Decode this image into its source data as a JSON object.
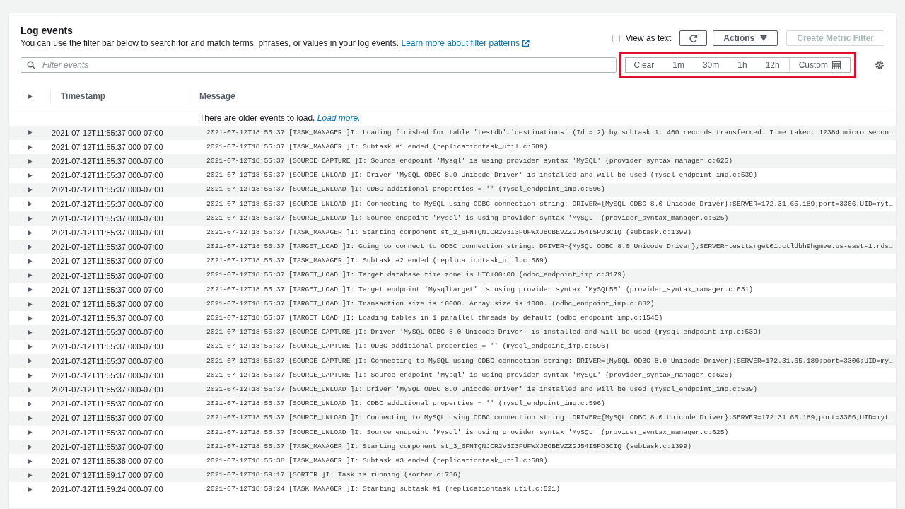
{
  "panel": {
    "title": "Log events",
    "description": "You can use the filter bar below to search for and match terms, phrases, or values in your log events.",
    "learn_more_link": "Learn more about filter patterns"
  },
  "view_as_text": {
    "label": "View as text",
    "checked": false
  },
  "actions_button": "Actions",
  "create_metric_filter": {
    "label": "Create Metric Filter",
    "disabled": true
  },
  "search": {
    "placeholder": "Filter events"
  },
  "time_range": [
    {
      "label": "Clear",
      "kind": "text"
    },
    {
      "label": "1m",
      "kind": "text"
    },
    {
      "label": "30m",
      "kind": "text"
    },
    {
      "label": "1h",
      "kind": "text"
    },
    {
      "label": "12h",
      "kind": "text"
    },
    {
      "label": "Custom",
      "kind": "calendar"
    }
  ],
  "table": {
    "columns": [
      "Timestamp",
      "Message"
    ],
    "load_more": {
      "text": "There are older events to load.",
      "link": "Load more."
    },
    "rows": [
      {
        "timestamp": "2021-07-12T11:55:37.000-07:00",
        "message": "2021-07-12T18:55:37 [TASK_MANAGER ]I: Loading finished for table 'testdb'.'destinations' (Id = 2) by subtask 1. 400 records transferred. Time taken: 12384 micro secon…",
        "expanded": false
      },
      {
        "timestamp": "2021-07-12T11:55:37.000-07:00",
        "message": "2021-07-12T18:55:37 [TASK_MANAGER ]I: Subtask #1 ended (replicationtask_util.c:589)",
        "expanded": false
      },
      {
        "timestamp": "2021-07-12T11:55:37.000-07:00",
        "message": "2021-07-12T18:55:37 [SOURCE_CAPTURE ]I: Source endpoint 'Mysql' is using provider syntax 'MySQL' (provider_syntax_manager.c:625)",
        "expanded": false
      },
      {
        "timestamp": "2021-07-12T11:55:37.000-07:00",
        "message": "2021-07-12T18:55:37 [SOURCE_UNLOAD ]I: Driver 'MySQL ODBC 8.0 Unicode Driver' is installed and will be used (mysql_endpoint_imp.c:539)",
        "expanded": false
      },
      {
        "timestamp": "2021-07-12T11:55:37.000-07:00",
        "message": "2021-07-12T18:55:37 [SOURCE_UNLOAD ]I: ODBC additional properties = '' (mysql_endpoint_imp.c:596)",
        "expanded": false
      },
      {
        "timestamp": "2021-07-12T11:55:37.000-07:00",
        "message": "2021-07-12T18:55:37 [SOURCE_UNLOAD ]I: Connecting to MySQL using ODBC connection string: DRIVER={MySQL ODBC 8.0 Unicode Driver};SERVER=172.31.65.189;port=3306;UID=myt…",
        "expanded": false
      },
      {
        "timestamp": "2021-07-12T11:55:37.000-07:00",
        "message": "2021-07-12T18:55:37 [SOURCE_UNLOAD ]I: Source endpoint 'Mysql' is using provider syntax 'MySQL' (provider_syntax_manager.c:625)",
        "expanded": false
      },
      {
        "timestamp": "2021-07-12T11:55:37.000-07:00",
        "message": "2021-07-12T18:55:37 [TASK_MANAGER ]I: Starting component st_2_6FNTQNJCR2V3I3FUFWXJBOBEVZZGJ54I5PD3CIQ (subtask.c:1399)",
        "expanded": false
      },
      {
        "timestamp": "2021-07-12T11:55:37.000-07:00",
        "message": "2021-07-12T18:55:37 [TARGET_LOAD ]I: Going to connect to ODBC connection string: DRIVER={MySQL ODBC 8.0 Unicode Driver};SERVER=testtarget01.ctldbh9hgmve.us-east-1.rds…",
        "expanded": false
      },
      {
        "timestamp": "2021-07-12T11:55:37.000-07:00",
        "message": "2021-07-12T18:55:37 [TASK_MANAGER ]I: Subtask #2 ended (replicationtask_util.c:589)",
        "expanded": false
      },
      {
        "timestamp": "2021-07-12T11:55:37.000-07:00",
        "message": "2021-07-12T18:55:37 [TARGET_LOAD ]I: Target database time zone is UTC+00:00 (odbc_endpoint_imp.c:3179)",
        "expanded": false
      },
      {
        "timestamp": "2021-07-12T11:55:37.000-07:00",
        "message": "2021-07-12T18:55:37 [TARGET_LOAD ]I: Target endpoint 'Mysqltarget' is using provider syntax 'MySQL55' (provider_syntax_manager.c:631)",
        "expanded": false
      },
      {
        "timestamp": "2021-07-12T11:55:37.000-07:00",
        "message": "2021-07-12T18:55:37 [TARGET_LOAD ]I: Transaction size is 10000. Array size is 1000. (odbc_endpoint_imp.c:882)",
        "expanded": false
      },
      {
        "timestamp": "2021-07-12T11:55:37.000-07:00",
        "message": "2021-07-12T18:55:37 [TARGET_LOAD ]I: Loading tables in 1 parallel threads by default (odbc_endpoint_imp.c:1545)",
        "expanded": false
      },
      {
        "timestamp": "2021-07-12T11:55:37.000-07:00",
        "message": "2021-07-12T18:55:37 [SOURCE_CAPTURE ]I: Driver 'MySQL ODBC 8.0 Unicode Driver' is installed and will be used (mysql_endpoint_imp.c:539)",
        "expanded": false
      },
      {
        "timestamp": "2021-07-12T11:55:37.000-07:00",
        "message": "2021-07-12T18:55:37 [SOURCE_CAPTURE ]I: ODBC additional properties = '' (mysql_endpoint_imp.c:596)",
        "expanded": false
      },
      {
        "timestamp": "2021-07-12T11:55:37.000-07:00",
        "message": "2021-07-12T18:55:37 [SOURCE_CAPTURE ]I: Connecting to MySQL using ODBC connection string: DRIVER={MySQL ODBC 8.0 Unicode Driver};SERVER=172.31.65.189;port=3306;UID=my…",
        "expanded": false
      },
      {
        "timestamp": "2021-07-12T11:55:37.000-07:00",
        "message": "2021-07-12T18:55:37 [SOURCE_CAPTURE ]I: Source endpoint 'Mysql' is using provider syntax 'MySQL' (provider_syntax_manager.c:625)",
        "expanded": false
      },
      {
        "timestamp": "2021-07-12T11:55:37.000-07:00",
        "message": "2021-07-12T18:55:37 [SOURCE_UNLOAD ]I: Driver 'MySQL ODBC 8.0 Unicode Driver' is installed and will be used (mysql_endpoint_imp.c:539)",
        "expanded": false
      },
      {
        "timestamp": "2021-07-12T11:55:37.000-07:00",
        "message": "2021-07-12T18:55:37 [SOURCE_UNLOAD ]I: ODBC additional properties = '' (mysql_endpoint_imp.c:596)",
        "expanded": false
      },
      {
        "timestamp": "2021-07-12T11:55:37.000-07:00",
        "message": "2021-07-12T18:55:37 [SOURCE_UNLOAD ]I: Connecting to MySQL using ODBC connection string: DRIVER={MySQL ODBC 8.0 Unicode Driver};SERVER=172.31.65.189;port=3306;UID=myt…",
        "expanded": false
      },
      {
        "timestamp": "2021-07-12T11:55:37.000-07:00",
        "message": "2021-07-12T18:55:37 [SOURCE_UNLOAD ]I: Source endpoint 'Mysql' is using provider syntax 'MySQL' (provider_syntax_manager.c:625)",
        "expanded": false
      },
      {
        "timestamp": "2021-07-12T11:55:37.000-07:00",
        "message": "2021-07-12T18:55:37 [TASK_MANAGER ]I: Starting component st_3_6FNTQNJCR2V3I3FUFWXJBOBEVZZGJ54I5PD3CIQ (subtask.c:1399)",
        "expanded": false
      },
      {
        "timestamp": "2021-07-12T11:55:38.000-07:00",
        "message": "2021-07-12T18:55:38 [TASK_MANAGER ]I: Subtask #3 ended (replicationtask_util.c:589)",
        "expanded": false
      },
      {
        "timestamp": "2021-07-12T11:59:17.000-07:00",
        "message": "2021-07-12T18:59:17 [SORTER ]I: Task is running (sorter.c:736)",
        "expanded": false
      },
      {
        "timestamp": "2021-07-12T11:59:24.000-07:00",
        "message": "2021-07-12T18:59:24 [TASK_MANAGER ]I: Starting subtask #1 (replicationtask_util.c:521)",
        "expanded": false
      }
    ]
  }
}
